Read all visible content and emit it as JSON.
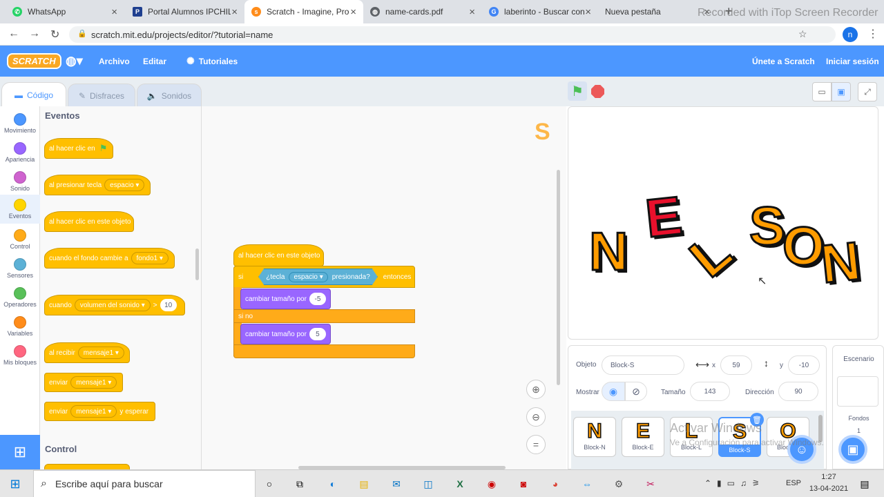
{
  "browser": {
    "tabs": [
      {
        "label": "WhatsApp",
        "icon": "whatsapp-icon",
        "color": "#25d366"
      },
      {
        "label": "Portal Alumnos IPCHILE",
        "icon": "portal-icon",
        "color": "#1f3f8f"
      },
      {
        "label": "Scratch - Imagine, Progr",
        "icon": "scratch-cat-icon",
        "color": "#ff8c1a"
      },
      {
        "label": "name-cards.pdf",
        "icon": "globe-icon",
        "color": "#5f6368"
      },
      {
        "label": "laberinto - Buscar con",
        "icon": "google-icon",
        "color": "#4285f4"
      },
      {
        "label": "Nueva pestaña",
        "icon": "",
        "color": ""
      }
    ],
    "new_tab": "+",
    "recorder_watermark": "Recorded with iTop Screen Recorder",
    "url": "scratch.mit.edu/projects/editor/?tutorial=name",
    "profile_initial": "n"
  },
  "menu": {
    "logo": "SCRATCH",
    "archivo": "Archivo",
    "editar": "Editar",
    "tutoriales": "Tutoriales",
    "join": "Únete a Scratch",
    "signin": "Iniciar sesión"
  },
  "editor_tabs": {
    "code": "Código",
    "costumes": "Disfraces",
    "sounds": "Sonidos"
  },
  "categories": [
    {
      "label": "Movimiento",
      "color": "#4c97ff"
    },
    {
      "label": "Apariencia",
      "color": "#9966ff"
    },
    {
      "label": "Sonido",
      "color": "#cf63cf"
    },
    {
      "label": "Eventos",
      "color": "#ffd500"
    },
    {
      "label": "Control",
      "color": "#ffab19"
    },
    {
      "label": "Sensores",
      "color": "#5cb1d6"
    },
    {
      "label": "Operadores",
      "color": "#59c059"
    },
    {
      "label": "Variables",
      "color": "#ff8c1a"
    },
    {
      "label": "Mis bloques",
      "color": "#ff6680"
    }
  ],
  "palette": {
    "section_events": "Eventos",
    "section_control": "Control",
    "when_flag": "al hacer clic en",
    "when_key": "al presionar tecla",
    "key_value": "espacio",
    "when_sprite_clicked": "al hacer clic en este objeto",
    "when_backdrop": "cuando el fondo cambie a",
    "backdrop_value": "fondo1",
    "when_greater": "cuando",
    "loudness": "volumen del sonido",
    "gt": ">",
    "gt_value": "10",
    "when_receive": "al recibir",
    "message": "mensaje1",
    "broadcast": "enviar",
    "broadcast_wait_suffix": "y esperar"
  },
  "script": {
    "hat": "al hacer clic en este objeto",
    "if": "si",
    "key_pressed_pre": "¿tecla",
    "key_value": "espacio",
    "key_pressed_post": "presionada?",
    "then": "entonces",
    "change_size": "cambiar tamaño por",
    "value1": "-5",
    "else": "si no",
    "value2": "5"
  },
  "sprite_info": {
    "label_sprite": "Objeto",
    "name": "Block-S",
    "x_label": "x",
    "x": "59",
    "y_label": "y",
    "y": "-10",
    "show_label": "Mostrar",
    "size_label": "Tamaño",
    "size": "143",
    "direction_label": "Dirección",
    "direction": "90"
  },
  "sprites": [
    {
      "letter": "N",
      "name": "Block-N"
    },
    {
      "letter": "E",
      "name": "Block-E"
    },
    {
      "letter": "L",
      "name": "Block-L"
    },
    {
      "letter": "S",
      "name": "Block-S"
    },
    {
      "letter": "O",
      "name": "Block-O"
    }
  ],
  "activate_windows": "Activar Windows",
  "activate_windows_sub": "Ve a Configuración para activar Windows.",
  "stage_panel": {
    "title": "Escenario",
    "backdrops_label": "Fondos",
    "backdrops_count": "1"
  },
  "stage_letters": [
    "N",
    "E",
    "L",
    "S",
    "O",
    "N"
  ],
  "taskbar": {
    "search": "Escribe aquí para buscar",
    "time": "1:27",
    "date": "13-04-2021",
    "lang": "ESP"
  }
}
